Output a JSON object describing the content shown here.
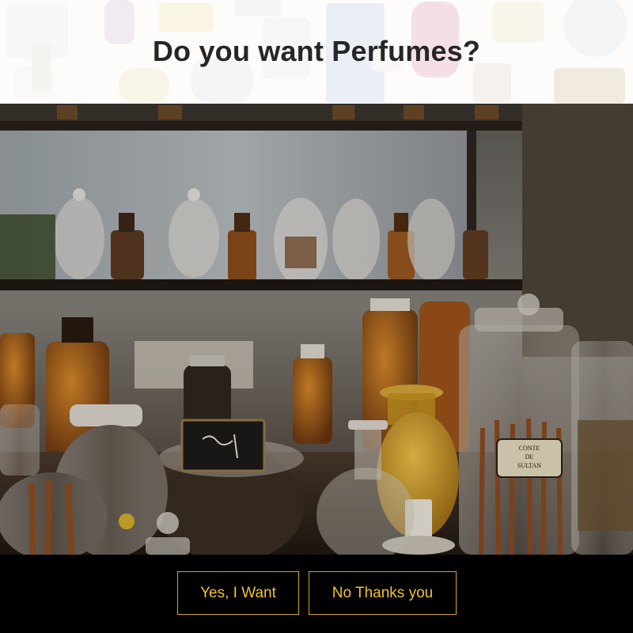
{
  "popup": {
    "title": "Do you want Perfumes?"
  },
  "hero": {
    "jar_label_line1": "CONTE",
    "jar_label_line2": "DE",
    "jar_label_line3": "SULTAN"
  },
  "actions": {
    "yes_label": "Yes, I Want",
    "no_label": "No Thanks you"
  },
  "colors": {
    "button_accent": "#f2c230",
    "footer_background": "#000000",
    "title_text": "#262626"
  }
}
